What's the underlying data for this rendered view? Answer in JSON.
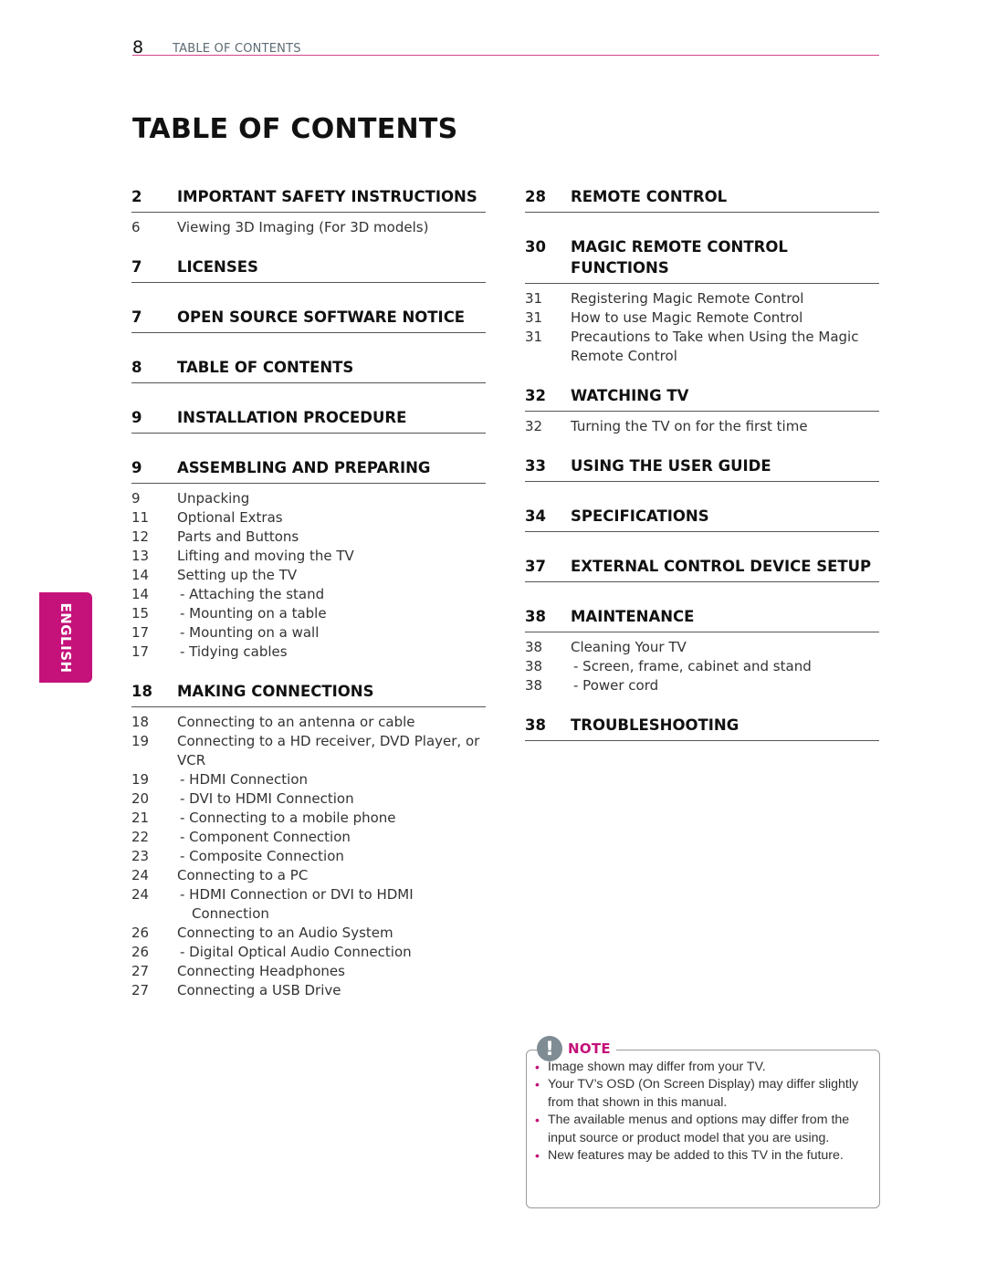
{
  "running_header": {
    "page_number": "8",
    "title": "TABLE OF CONTENTS"
  },
  "page_title": "TABLE OF CONTENTS",
  "language_tab": "ENGLISH",
  "colors": {
    "accent": "#c4127a",
    "rule": "#d4458a",
    "note_icon": "#7f8c93"
  },
  "left_column": [
    {
      "page": "2",
      "title": "IMPORTANT SAFETY INSTRUCTIONS",
      "entries": [
        {
          "page": "6",
          "text": "Viewing 3D Imaging (For 3D models)",
          "sub": false
        }
      ]
    },
    {
      "page": "7",
      "title": "LICENSES",
      "entries": []
    },
    {
      "page": "7",
      "title": "OPEN SOURCE SOFTWARE NOTICE",
      "entries": []
    },
    {
      "page": "8",
      "title": "TABLE OF CONTENTS",
      "entries": []
    },
    {
      "page": "9",
      "title": "INSTALLATION PROCEDURE",
      "entries": []
    },
    {
      "page": "9",
      "title": "ASSEMBLING AND PREPARING",
      "entries": [
        {
          "page": "9",
          "text": "Unpacking",
          "sub": false
        },
        {
          "page": "11",
          "text": "Optional Extras",
          "sub": false
        },
        {
          "page": "12",
          "text": "Parts and Buttons",
          "sub": false
        },
        {
          "page": "13",
          "text": "Lifting and moving the TV",
          "sub": false
        },
        {
          "page": "14",
          "text": "Setting up the TV",
          "sub": false
        },
        {
          "page": "14",
          "text": "- Attaching the stand",
          "sub": true
        },
        {
          "page": "15",
          "text": "- Mounting on a table",
          "sub": true
        },
        {
          "page": "17",
          "text": "- Mounting on a wall",
          "sub": true
        },
        {
          "page": "17",
          "text": "- Tidying cables",
          "sub": true
        }
      ]
    },
    {
      "page": "18",
      "title": "MAKING CONNECTIONS",
      "entries": [
        {
          "page": "18",
          "text": "Connecting to an antenna or cable",
          "sub": false
        },
        {
          "page": "19",
          "text": "Connecting to a HD receiver, DVD Player, or VCR",
          "sub": false
        },
        {
          "page": "19",
          "text": "- HDMI Connection",
          "sub": true
        },
        {
          "page": "20",
          "text": "- DVI to HDMI Connection",
          "sub": true
        },
        {
          "page": "21",
          "text": "- Connecting to a mobile phone",
          "sub": true
        },
        {
          "page": "22",
          "text": "- Component Connection",
          "sub": true
        },
        {
          "page": "23",
          "text": "- Composite Connection",
          "sub": true
        },
        {
          "page": "24",
          "text": "Connecting to a PC",
          "sub": false
        },
        {
          "page": "24",
          "text": "- HDMI Connection or DVI to HDMI Connection",
          "sub": true
        },
        {
          "page": "26",
          "text": "Connecting to an Audio System",
          "sub": false
        },
        {
          "page": "26",
          "text": "- Digital Optical Audio Connection",
          "sub": true
        },
        {
          "page": "27",
          "text": "Connecting Headphones",
          "sub": false
        },
        {
          "page": "27",
          "text": "Connecting a USB Drive",
          "sub": false
        }
      ]
    }
  ],
  "right_column": [
    {
      "page": "28",
      "title": "REMOTE CONTROL",
      "entries": []
    },
    {
      "page": "30",
      "title": "MAGIC REMOTE CONTROL FUNCTIONS",
      "entries": [
        {
          "page": "31",
          "text": "Registering Magic Remote Control",
          "sub": false
        },
        {
          "page": "31",
          "text": "How to use Magic Remote Control",
          "sub": false
        },
        {
          "page": "31",
          "text": "Precautions to Take when Using the Magic Remote Control",
          "sub": false
        }
      ]
    },
    {
      "page": "32",
      "title": "WATCHING TV",
      "entries": [
        {
          "page": "32",
          "text": "Turning the TV on for the first time",
          "sub": false
        }
      ]
    },
    {
      "page": "33",
      "title": "USING THE USER GUIDE",
      "entries": []
    },
    {
      "page": "34",
      "title": "SPECIFICATIONS",
      "entries": []
    },
    {
      "page": "37",
      "title": "EXTERNAL CONTROL DEVICE SETUP",
      "entries": []
    },
    {
      "page": "38",
      "title": "MAINTENANCE",
      "entries": [
        {
          "page": "38",
          "text": "Cleaning Your TV",
          "sub": false
        },
        {
          "page": "38",
          "text": "- Screen, frame, cabinet and stand",
          "sub": true
        },
        {
          "page": "38",
          "text": "- Power cord",
          "sub": true
        }
      ]
    },
    {
      "page": "38",
      "title": "TROUBLESHOOTING",
      "entries": []
    }
  ],
  "note": {
    "icon": "exclamation-icon",
    "icon_glyph": "!",
    "label": "NOTE",
    "bullet": "•",
    "items": [
      "Image shown may differ from your TV.",
      "Your TV’s OSD (On Screen Display) may differ slightly from that shown in this manual.",
      "The available menus and options may differ from the input source or product model that you are using.",
      "New features may be added to this TV in the future."
    ]
  }
}
